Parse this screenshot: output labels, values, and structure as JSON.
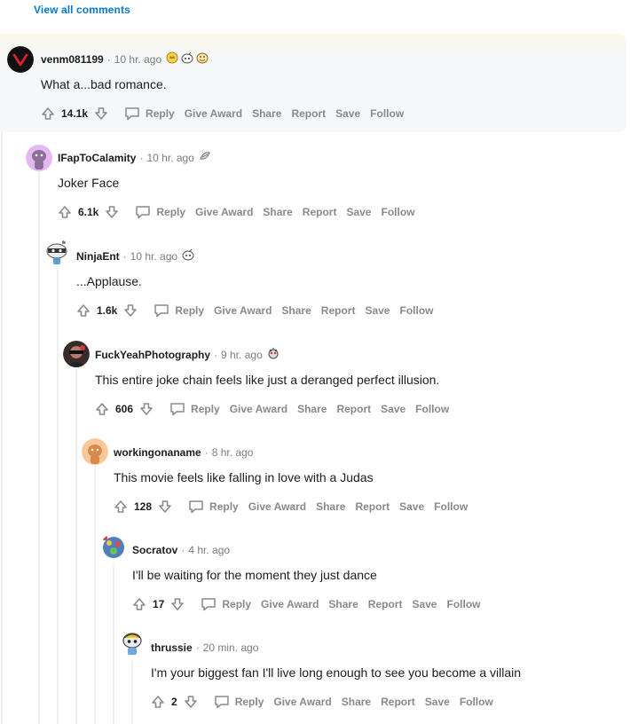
{
  "view_all_comments": "View all comments",
  "actions": {
    "reply": "Reply",
    "give_award": "Give Award",
    "share": "Share",
    "report": "Report",
    "save": "Save",
    "follow": "Follow"
  },
  "comments": [
    {
      "username": "venm081199",
      "sep": "·",
      "time": "10 hr. ago",
      "body": "What a...bad romance.",
      "score": "14.1k",
      "awards": [
        "gold-award-icon",
        "helpful-award-icon",
        "wholesome-award-icon"
      ]
    },
    {
      "username": "IFapToCalamity",
      "sep": "·",
      "time": "10 hr. ago",
      "body": "Joker Face",
      "score": "6.1k",
      "awards": [
        "silver-award-icon"
      ]
    },
    {
      "username": "NinjaEnt",
      "sep": "·",
      "time": "10 hr. ago",
      "body": "...Applause.",
      "score": "1.6k",
      "awards": [
        "helpful-award-icon"
      ]
    },
    {
      "username": "FuckYeahPhotography",
      "sep": "·",
      "time": "9 hr. ago",
      "body": "This entire joke chain feels like just a deranged perfect illusion.",
      "score": "606",
      "awards": [
        "rocket-like-award-icon"
      ]
    },
    {
      "username": "workingonaname",
      "sep": "·",
      "time": "8 hr. ago",
      "body": "This movie feels like falling in love with a Judas",
      "score": "128",
      "awards": []
    },
    {
      "username": "Socratov",
      "sep": "·",
      "time": "4 hr. ago",
      "body": "I'll be waiting for the moment they just dance",
      "score": "17",
      "awards": []
    },
    {
      "username": "thrussie",
      "sep": "·",
      "time": "20 min. ago",
      "body": "I'm your biggest fan I'll live long enough to see you become a villain",
      "score": "2",
      "awards": []
    }
  ],
  "colors": {
    "link": "#0079d3",
    "meta": "#7c7c7c",
    "action": "#878a8c",
    "highlight": "#f6f7f8"
  }
}
